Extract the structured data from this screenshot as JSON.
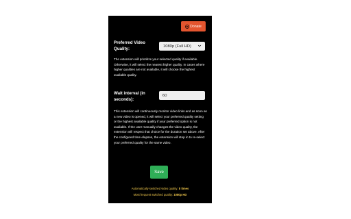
{
  "donate": {
    "label": "Donate"
  },
  "preferred_quality": {
    "label_line1": "Preferred Video",
    "label_line2": "Quality:",
    "selected": "1080p (Full HD)",
    "description": "The extension will prioritize your selected quality if available. Otherwise, it will select the nearest higher quality. In cases where higher qualities are not available, it will choose the highest available quality."
  },
  "wait_interval": {
    "label_line1": "Wait interval (in",
    "label_line2": "seconds):",
    "value": "60",
    "description": "This extension will continuously monitor video links and as soon as a new video is opened, it will select your preferred quality setting or the highest available quality if your preferred option is not available. If the user manually changes the video quality, the extension will respect that choice for the duration set above. After the configured time elapses, the extension will step in to re-select your preferred quality for the same video."
  },
  "save": {
    "label": "Save"
  },
  "stats": {
    "switched_prefix": "Automatically switched video quality:",
    "switched_value": "8 times",
    "frequent_prefix": "Most frequent switched quality:",
    "frequent_value": "1080p HD"
  },
  "colors": {
    "background": "#000000",
    "donate": "#e4552f",
    "save": "#2fae57",
    "stats_text": "#f2c94c"
  },
  "icons": {
    "donate": "coin-icon",
    "dropdown": "chevron-down-icon"
  }
}
